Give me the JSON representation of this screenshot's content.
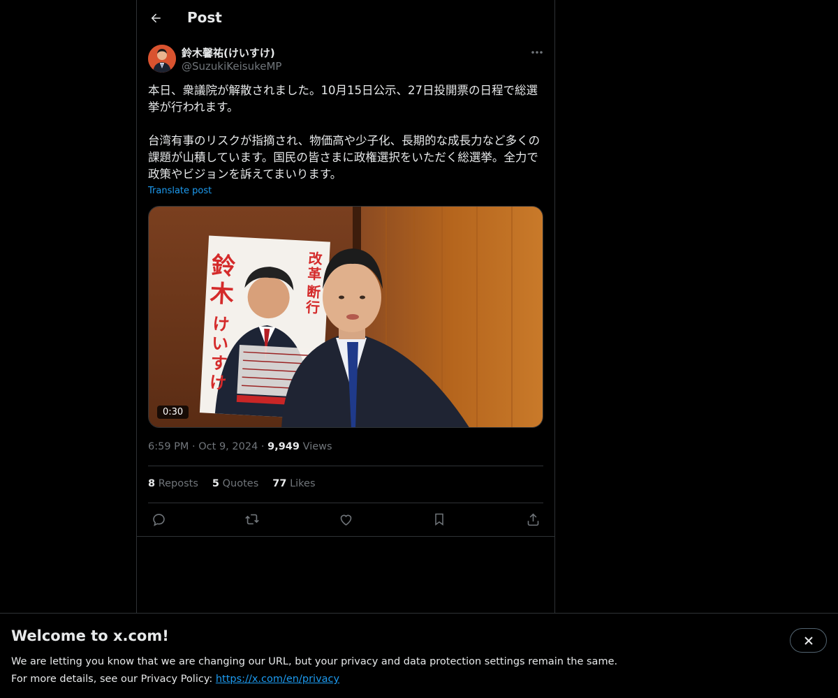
{
  "header": {
    "title": "Post"
  },
  "author": {
    "name": "鈴木馨祐(けいすけ)",
    "handle": "@SuzukiKeisukeMP"
  },
  "tweet": {
    "paragraphs": [
      "本日、衆議院が解散されました。10月15日公示、27日投開票の日程で総選挙が行われます。",
      "台湾有事のリスクが指摘され、物価高や少子化、長期的な成長力など多くの課題が山積しています。国民の皆さまに政権選択をいただく総選挙。全力で政策やビジョンを訴えてまいります。"
    ],
    "translate_label": "Translate post"
  },
  "media": {
    "duration": "0:30",
    "poster_text": {
      "slogan": "改革、断行。",
      "name": "鈴木けいすけ"
    }
  },
  "meta": {
    "time": "6:59 PM",
    "date": "Oct 9, 2024",
    "views_count": "9,949",
    "views_label": "Views"
  },
  "stats": {
    "reposts": {
      "count": "8",
      "label": "Reposts"
    },
    "quotes": {
      "count": "5",
      "label": "Quotes"
    },
    "likes": {
      "count": "77",
      "label": "Likes"
    }
  },
  "actions": [
    "reply-icon",
    "repost-icon",
    "like-icon",
    "bookmark-icon",
    "share-icon"
  ],
  "banner": {
    "title": "Welcome to x.com!",
    "line1": "We are letting you know that we are changing our URL, but your privacy and data protection settings remain the same.",
    "line2_prefix": "For more details, see our Privacy Policy: ",
    "link": "https://x.com/en/privacy"
  },
  "colors": {
    "background": "#000000",
    "text": "#e7e9ea",
    "muted": "#71767b",
    "accent": "#1d9bf0",
    "border": "#2f3336"
  }
}
